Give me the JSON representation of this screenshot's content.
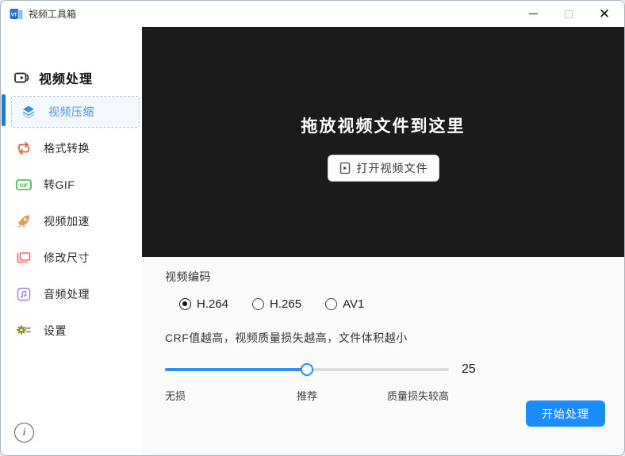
{
  "window": {
    "title": "视频工具箱",
    "controls": {
      "minimize": "minimize",
      "maximize": "maximize",
      "close": "✕"
    }
  },
  "sidebar": {
    "header": {
      "label": "视频处理",
      "icon": "video-camera-icon"
    },
    "items": [
      {
        "label": "视频压缩",
        "icon": "layers-icon",
        "color": "#3d8fd1",
        "selected": true
      },
      {
        "label": "格式转换",
        "icon": "swap-cycle-icon",
        "color": "#e2603e",
        "selected": false
      },
      {
        "label": "转GIF",
        "icon": "gif-badge-icon",
        "color": "#3faf4e",
        "selected": false
      },
      {
        "label": "视频加速",
        "icon": "rocket-icon",
        "color": "#e89a54",
        "selected": false
      },
      {
        "label": "修改尺寸",
        "icon": "resize-icon",
        "color": "#f06a6a",
        "selected": false
      },
      {
        "label": "音频处理",
        "icon": "music-note-icon",
        "color": "#9f86d8",
        "selected": false
      },
      {
        "label": "设置",
        "icon": "gear-icon",
        "color": "#8a8a2a",
        "selected": false
      }
    ],
    "info_icon": "i"
  },
  "dropzone": {
    "title": "拖放视频文件到这里",
    "open_button_label": "打开视频文件",
    "open_button_icon": "file-play-icon"
  },
  "encoding": {
    "label": "视频编码",
    "options": [
      {
        "label": "H.264",
        "selected": true
      },
      {
        "label": "H.265",
        "selected": false
      },
      {
        "label": "AV1",
        "selected": false
      }
    ]
  },
  "crf": {
    "description": "CRF值越高，视频质量损失越高，文件体积越小",
    "value": "25",
    "slider_percent": 50,
    "labels": {
      "left": "无损",
      "center": "推荐",
      "right": "质量损失较高"
    }
  },
  "actions": {
    "start_label": "开始处理"
  },
  "colors": {
    "accent_blue": "#1b8cfa",
    "slider_blue": "#2e90f2",
    "selected_item_blue": "#4a96dd",
    "dropzone_bg": "#1b1b1d",
    "panel_bg": "#fafafa"
  }
}
